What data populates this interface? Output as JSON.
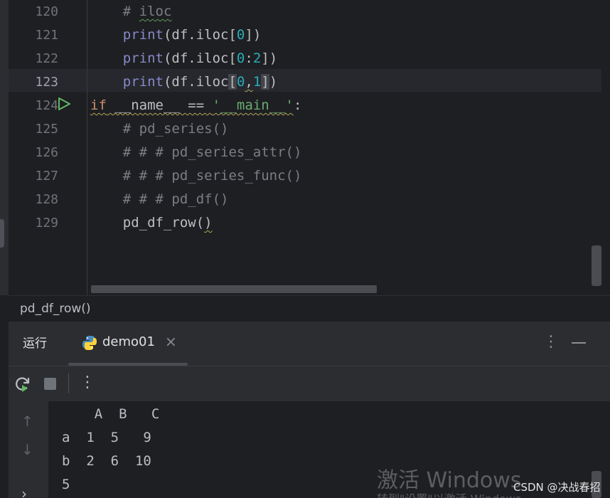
{
  "editor": {
    "lines": [
      {
        "number": "120",
        "parts": [
          {
            "text": "    ",
            "cls": ""
          },
          {
            "text": "# ",
            "cls": "comment"
          },
          {
            "text": "iloc",
            "cls": "comment wavy-green"
          }
        ]
      },
      {
        "number": "121",
        "parts": [
          {
            "text": "    ",
            "cls": ""
          },
          {
            "text": "print",
            "cls": "builtin"
          },
          {
            "text": "(df.iloc[",
            "cls": ""
          },
          {
            "text": "0",
            "cls": "num"
          },
          {
            "text": "])",
            "cls": ""
          }
        ]
      },
      {
        "number": "122",
        "parts": [
          {
            "text": "    ",
            "cls": ""
          },
          {
            "text": "print",
            "cls": "builtin"
          },
          {
            "text": "(df.iloc[",
            "cls": ""
          },
          {
            "text": "0",
            "cls": "num"
          },
          {
            "text": ":",
            "cls": ""
          },
          {
            "text": "2",
            "cls": "num"
          },
          {
            "text": "])",
            "cls": ""
          }
        ]
      },
      {
        "number": "123",
        "active": true,
        "parts": [
          {
            "text": "    ",
            "cls": ""
          },
          {
            "text": "print",
            "cls": "builtin"
          },
          {
            "text": "(df.iloc",
            "cls": ""
          },
          {
            "text": "[",
            "cls": "bracket"
          },
          {
            "text": "0",
            "cls": "num"
          },
          {
            "text": ",",
            "cls": "wavy"
          },
          {
            "text": "1",
            "cls": "num"
          },
          {
            "text": "]",
            "cls": "bracket"
          },
          {
            "text": ")",
            "cls": ""
          }
        ]
      },
      {
        "number": "124",
        "run": true,
        "parts": [
          {
            "text": "if",
            "cls": "kw wavy"
          },
          {
            "text": " __name__ == ",
            "cls": "wavy"
          },
          {
            "text": "'__main__'",
            "cls": "str wavy"
          },
          {
            "text": ":",
            "cls": ""
          }
        ]
      },
      {
        "number": "125",
        "parts": [
          {
            "text": "    ",
            "cls": ""
          },
          {
            "text": "# pd_series()",
            "cls": "comment"
          }
        ]
      },
      {
        "number": "126",
        "parts": [
          {
            "text": "    ",
            "cls": ""
          },
          {
            "text": "# # # pd_series_attr()",
            "cls": "comment"
          }
        ]
      },
      {
        "number": "127",
        "parts": [
          {
            "text": "    ",
            "cls": ""
          },
          {
            "text": "# # # pd_series_func()",
            "cls": "comment"
          }
        ]
      },
      {
        "number": "128",
        "parts": [
          {
            "text": "    ",
            "cls": ""
          },
          {
            "text": "# # # pd_df()",
            "cls": "comment"
          }
        ]
      },
      {
        "number": "129",
        "parts": [
          {
            "text": "    ",
            "cls": ""
          },
          {
            "text": "pd_df_row(",
            "cls": ""
          },
          {
            "text": ")",
            "cls": "wavy"
          }
        ]
      }
    ]
  },
  "breadcrumb": "pd_df_row()",
  "run_panel": {
    "title": "运行",
    "tab_label": "demo01",
    "close_glyph": "×",
    "more_glyph": "⋮"
  },
  "console": {
    "lines": [
      "    A  B   C",
      "a  1  5   9",
      "b  2  6  10",
      "5"
    ]
  },
  "icons": {
    "up": "↑",
    "down": "↓",
    "expand": "›"
  },
  "watermark": {
    "main": "激活 Windows",
    "sub": "转到\"设置\"以激活 Windows。"
  },
  "csdn_credit": "CSDN @决战春招",
  "colors": {
    "keyword": "#cf8e6d",
    "builtin": "#8888c6",
    "number": "#2aacb8",
    "string": "#6aab73",
    "comment": "#7a7e85",
    "run_green": "#5fb865"
  }
}
